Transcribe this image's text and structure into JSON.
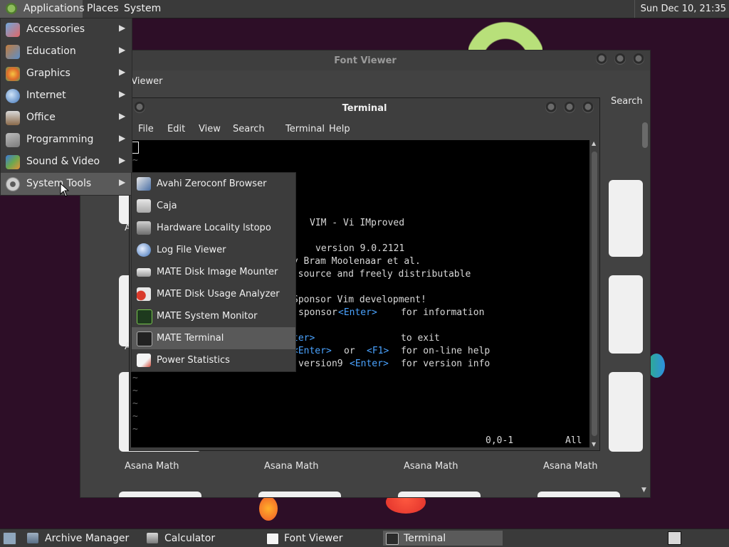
{
  "top_panel": {
    "menus": [
      "Applications",
      "Places",
      "System"
    ],
    "clock": "Sun Dec 10, 21:35"
  },
  "font_viewer": {
    "title": "Font Viewer",
    "toolbar_label": "t Viewer",
    "search_label": "Search",
    "font_names": [
      "Asana Math",
      "Asana Math",
      "Asana Math",
      "Asana Math"
    ],
    "partial_labels": [
      "A",
      "A"
    ]
  },
  "terminal": {
    "title": "Terminal",
    "menu": [
      "File",
      "Edit",
      "View",
      "Search",
      "Terminal",
      "Help"
    ],
    "vim_lines": {
      "title": "VIM - Vi IMproved",
      "version": "version 9.0.2121",
      "author": "by Bram Moolenaar et al.",
      "license": "n source and freely distributable",
      "sponsor": "Sponsor Vim development!",
      "sponsor_cmd": "sponsor",
      "sponsor_info": "for information",
      "exit_enter_fragment": "ter>",
      "exit_info": "to exit",
      "help_enter": "<Enter>",
      "help_or": "or",
      "help_f1": "<F1>",
      "help_info": "for on-line help",
      "version_cmd": "version9",
      "version_enter": "<Enter>",
      "version_info": "for version info",
      "enter": "<Enter>",
      "tilde": "~"
    },
    "status_position": "0,0-1",
    "status_all": "All"
  },
  "applications_menu": {
    "items": [
      {
        "label": "Accessories",
        "icon": "accessories-icon"
      },
      {
        "label": "Education",
        "icon": "education-icon"
      },
      {
        "label": "Graphics",
        "icon": "graphics-icon"
      },
      {
        "label": "Internet",
        "icon": "internet-icon"
      },
      {
        "label": "Office",
        "icon": "office-icon"
      },
      {
        "label": "Programming",
        "icon": "programming-icon"
      },
      {
        "label": "Sound & Video",
        "icon": "sound-video-icon"
      },
      {
        "label": "System Tools",
        "icon": "system-tools-icon"
      }
    ],
    "arrow": "▶"
  },
  "system_tools_menu": {
    "items": [
      {
        "label": "Avahi Zeroconf Browser",
        "icon": "avahi-icon"
      },
      {
        "label": "Caja",
        "icon": "caja-icon"
      },
      {
        "label": "Hardware Locality lstopo",
        "icon": "hardware-icon"
      },
      {
        "label": "Log File Viewer",
        "icon": "log-viewer-icon"
      },
      {
        "label": "MATE Disk Image Mounter",
        "icon": "disk-mounter-icon"
      },
      {
        "label": "MATE Disk Usage Analyzer",
        "icon": "disk-usage-icon"
      },
      {
        "label": "MATE System Monitor",
        "icon": "system-monitor-icon"
      },
      {
        "label": "MATE Terminal",
        "icon": "terminal-icon"
      },
      {
        "label": "Power Statistics",
        "icon": "power-stats-icon"
      }
    ],
    "highlighted": "MATE Terminal"
  },
  "taskbar": {
    "tasks": [
      {
        "label": "Archive Manager",
        "icon": "archive-manager-icon"
      },
      {
        "label": "Calculator",
        "icon": "calculator-icon"
      },
      {
        "label": "Font Viewer",
        "icon": "font-viewer-icon"
      },
      {
        "label": "Terminal",
        "icon": "terminal-icon"
      }
    ],
    "active_task": "Terminal"
  },
  "colors": {
    "desktop_bg": "#2d0e27",
    "panel_bg": "#3a3a3a",
    "menu_bg": "#3c3c3c",
    "vim_keyword": "#4aa3ff"
  }
}
